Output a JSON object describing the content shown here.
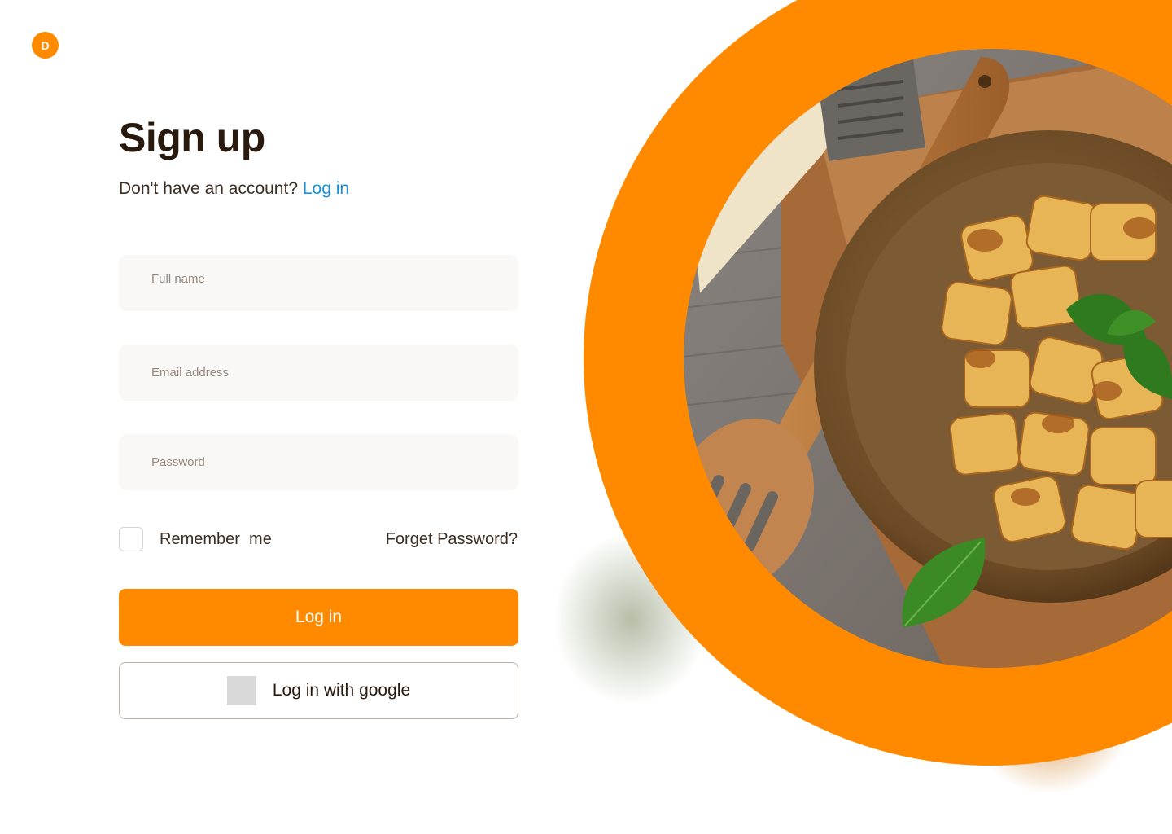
{
  "brand": {
    "logo_letter": "D"
  },
  "header": {
    "title": "Sign up",
    "prompt": "Don't have an account?",
    "login_link": "Log in"
  },
  "form": {
    "full_name_placeholder": "Full name",
    "email_placeholder": "Email address",
    "password_placeholder": "Password",
    "remember_label": "Remember  me",
    "forgot_label": "Forget Password?",
    "login_button": "Log in",
    "google_button": "Log in with google"
  },
  "colors": {
    "accent": "#ff8a00",
    "link": "#1a8fd8",
    "text": "#2a1a0e"
  },
  "hero": {
    "image": "food-photo-gnocchi"
  }
}
